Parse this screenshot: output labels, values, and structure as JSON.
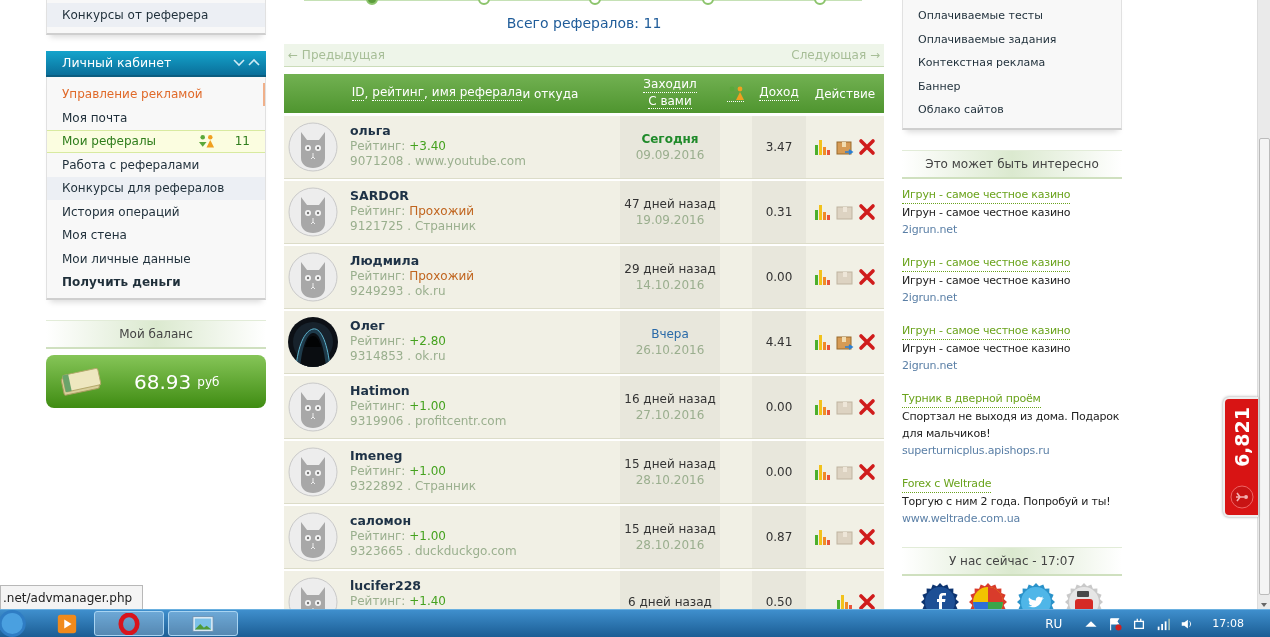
{
  "top_menu": {
    "items": [
      {
        "label": "Конкурсы от реферера",
        "shaded": true
      }
    ]
  },
  "cabinet": {
    "title": "Личный кабинет",
    "expanded": true,
    "items": [
      {
        "label": "Управление рекламой",
        "selected": false,
        "kind": "accent",
        "shaded": false
      },
      {
        "label": "Моя почта",
        "selected": false,
        "kind": "normal",
        "shaded": false
      },
      {
        "label": "Мои рефералы",
        "selected": true,
        "kind": "normal",
        "shaded": false,
        "count": "11"
      },
      {
        "label": "Работа с рефералами",
        "selected": false,
        "kind": "normal",
        "shaded": false
      },
      {
        "label": "Конкурсы для рефералов",
        "selected": false,
        "kind": "normal",
        "shaded": true
      },
      {
        "label": "История операций",
        "selected": false,
        "kind": "normal",
        "shaded": false
      },
      {
        "label": "Моя стена",
        "selected": false,
        "kind": "normal",
        "shaded": false
      },
      {
        "label": "Мои личные данные",
        "selected": false,
        "kind": "normal",
        "shaded": false
      },
      {
        "label": "Получить деньги",
        "selected": false,
        "kind": "strong",
        "shaded": false
      }
    ]
  },
  "balance": {
    "title": "Мой баланс",
    "amount": "68.93",
    "unit": "руб"
  },
  "steps": [
    {
      "selected": true
    },
    {
      "selected": false
    },
    {
      "selected": false
    },
    {
      "selected": false
    },
    {
      "selected": false
    }
  ],
  "referrals": {
    "total": "Всего рефералов: 11",
    "prev": "← Предыдущая",
    "next": "Следующая →",
    "header": {
      "links": [
        {
          "label": "ID",
          "after": ","
        },
        {
          "label": "рейтинг",
          "after": ","
        },
        {
          "label": "имя реферала",
          "after": "и откуда"
        }
      ],
      "visited": [
        "Заходил",
        "С вами"
      ],
      "income": "Доход",
      "action": "Действие"
    },
    "rows": [
      {
        "name": "ольга",
        "avatar": {
          "kind": "cat"
        },
        "rating_label": "Рейтинг:",
        "rating": {
          "text": "+3.40",
          "kind": "score"
        },
        "origin": "9071208 . www.youtube.com",
        "visited": {
          "text": "Сегодня",
          "kind": "today"
        },
        "date": "09.09.2016",
        "income": "3.47",
        "package": {
          "kind": "active"
        }
      },
      {
        "name": "SARDOR",
        "avatar": {
          "kind": "cat"
        },
        "rating_label": "Рейтинг:",
        "rating": {
          "text": "Прохожий",
          "kind": "status"
        },
        "origin": "9121725 . Странник",
        "visited": {
          "text": "47 дней назад",
          "kind": "days"
        },
        "date": "19.09.2016",
        "income": "0.31",
        "package": {
          "kind": "inactive"
        }
      },
      {
        "name": "Людмила",
        "avatar": {
          "kind": "cat"
        },
        "rating_label": "Рейтинг:",
        "rating": {
          "text": "Прохожий",
          "kind": "status"
        },
        "origin": "9249293 . ok.ru",
        "visited": {
          "text": "29 дней назад",
          "kind": "days"
        },
        "date": "14.10.2016",
        "income": "0.00",
        "package": {
          "kind": "inactive"
        }
      },
      {
        "name": "Олег",
        "rating_label": "Рейтинг:",
        "rating": {
          "text": "+2.80",
          "kind": "score"
        },
        "origin": "9314853 . ok.ru",
        "visited": {
          "text": "Вчера",
          "kind": "yesterday"
        },
        "date": "26.10.2016",
        "income": "4.41",
        "package": {
          "kind": "active"
        }
      },
      {
        "name": "Hatimon",
        "avatar": {
          "kind": "cat"
        },
        "rating_label": "Рейтинг:",
        "rating": {
          "text": "+1.00",
          "kind": "score"
        },
        "origin": "9319906 . profitcentr.com",
        "visited": {
          "text": "16 дней назад",
          "kind": "days"
        },
        "date": "27.10.2016",
        "income": "0.00",
        "package": {
          "kind": "inactive"
        }
      },
      {
        "name": "Imeneg",
        "avatar": {
          "kind": "cat"
        },
        "rating_label": "Рейтинг:",
        "rating": {
          "text": "+1.00",
          "kind": "score"
        },
        "origin": "9322892 . Странник",
        "visited": {
          "text": "15 дней назад",
          "kind": "days"
        },
        "date": "28.10.2016",
        "income": "0.00",
        "package": {
          "kind": "inactive"
        }
      },
      {
        "name": "саломон",
        "avatar": {
          "kind": "cat"
        },
        "rating_label": "Рейтинг:",
        "rating": {
          "text": "+1.00",
          "kind": "score"
        },
        "origin": "9323665 . duckduckgo.com",
        "visited": {
          "text": "15 дней назад",
          "kind": "days"
        },
        "date": "28.10.2016",
        "income": "0.87",
        "package": {
          "kind": "inactive"
        }
      },
      {
        "name": "lucifer228",
        "avatar": {
          "kind": "cat"
        },
        "rating_label": "Рейтинг:",
        "rating": {
          "text": "+1.40",
          "kind": "score"
        },
        "visited": {
          "text": "6 дней назад",
          "kind": "days"
        },
        "income": "0.50",
        "package": {
          "kind": "none"
        }
      }
    ]
  },
  "right_menu": {
    "items": [
      "Оплачиваемые тесты",
      "Оплачиваемые задания",
      "Контекстная реклама",
      "Баннер",
      "Облако сайтов"
    ]
  },
  "interesting": {
    "title": "Это может быть интересно",
    "ads": [
      {
        "title": "Игрун - самое честное казино",
        "text": "Игрун - самое честное казино",
        "url": "2igrun.net"
      },
      {
        "title": "Игрун - самое честное казино",
        "text": "Игрун - самое честное казино",
        "url": "2igrun.net"
      },
      {
        "title": "Игрун - самое честное казино",
        "text": "Игрун - самое честное казино",
        "url": "2igrun.net"
      },
      {
        "title": "Турник в дверной проём",
        "text": "Спортзал не выходя из дома. Подарок для мальчиков!",
        "url": "superturnicplus.apishops.ru"
      },
      {
        "title": "Forex с Weltrade",
        "text": "Торгую с ним 2 года. Попробуй и ты!",
        "url": "www.weltrade.com.ua"
      }
    ]
  },
  "now": {
    "title": "У нас сейчас - 17:07"
  },
  "social": [
    {
      "kind": "facebook"
    },
    {
      "kind": "google"
    },
    {
      "kind": "twitter"
    },
    {
      "kind": "youtube"
    }
  ],
  "widget": {
    "count": "6,821"
  },
  "status_url": ".net/advmanager.php",
  "taskbar": {
    "apps": [
      {
        "kind": "media",
        "open": false
      },
      {
        "kind": "opera",
        "open": true
      },
      {
        "kind": "photos",
        "open": true
      }
    ],
    "language": "RU",
    "clock": "17:08"
  }
}
